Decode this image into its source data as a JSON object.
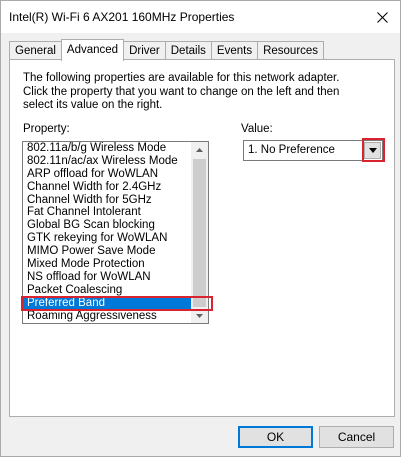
{
  "window": {
    "title": "Intel(R) Wi-Fi 6 AX201 160MHz Properties"
  },
  "tabs": [
    {
      "label": "General",
      "active": false
    },
    {
      "label": "Advanced",
      "active": true
    },
    {
      "label": "Driver",
      "active": false
    },
    {
      "label": "Details",
      "active": false
    },
    {
      "label": "Events",
      "active": false
    },
    {
      "label": "Resources",
      "active": false
    }
  ],
  "panel": {
    "description": "The following properties are available for this network adapter. Click the property that you want to change on the left and then select its value on the right.",
    "property_label": "Property:",
    "value_label": "Value:",
    "properties": [
      "802.11a/b/g Wireless Mode",
      "802.11n/ac/ax Wireless Mode",
      "ARP offload for WoWLAN",
      "Channel Width for 2.4GHz",
      "Channel Width for 5GHz",
      "Fat Channel Intolerant",
      "Global BG Scan blocking",
      "GTK rekeying for WoWLAN",
      "MIMO Power Save Mode",
      "Mixed Mode Protection",
      "NS offload for WoWLAN",
      "Packet Coalescing",
      "Preferred Band",
      "Roaming Aggressiveness"
    ],
    "selected_property": "Preferred Band",
    "value_selected": "1. No Preference"
  },
  "buttons": {
    "ok": "OK",
    "cancel": "Cancel"
  },
  "colors": {
    "selection": "#0078d7",
    "highlight_box": "#d9232f"
  }
}
